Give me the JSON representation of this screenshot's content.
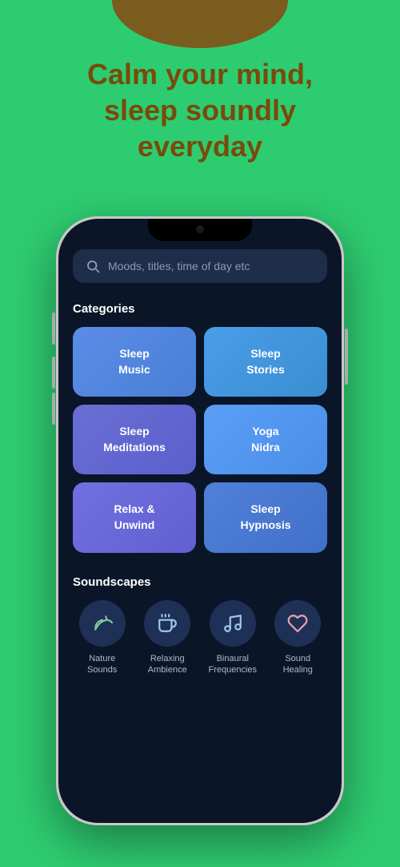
{
  "background": {
    "color": "#2ecc71",
    "arc_color": "#7a5c1e"
  },
  "headline": {
    "line1": "Calm your mind,",
    "line2": "sleep soundly",
    "line3": "everyday",
    "full": "Calm your mind,\nsleep soundly\neveryday",
    "color": "#7a4a0a"
  },
  "search": {
    "placeholder": "Moods, titles, time of day etc"
  },
  "categories_section": {
    "title": "Categories"
  },
  "categories": [
    {
      "id": "sleep-music",
      "label": "Sleep\nMusic",
      "css_class": "cat-sleep-music"
    },
    {
      "id": "sleep-stories",
      "label": "Sleep\nStories",
      "css_class": "cat-sleep-stories"
    },
    {
      "id": "sleep-meditations",
      "label": "Sleep\nMeditations",
      "css_class": "cat-sleep-meditations"
    },
    {
      "id": "yoga-nidra",
      "label": "Yoga\nNidra",
      "css_class": "cat-yoga-nidra"
    },
    {
      "id": "relax-unwind",
      "label": "Relax &\nUnwind",
      "css_class": "cat-relax-unwind"
    },
    {
      "id": "sleep-hypnosis",
      "label": "Sleep\nHypnosis",
      "css_class": "cat-sleep-hypnosis"
    }
  ],
  "soundscapes_section": {
    "title": "Soundscapes"
  },
  "soundscapes": [
    {
      "id": "nature-sounds",
      "icon": "🌿",
      "label": "Nature\nSounds"
    },
    {
      "id": "relaxing-ambience",
      "icon": "☕",
      "label": "Relaxing\nAmbience"
    },
    {
      "id": "binaural-frequencies",
      "icon": "🎵",
      "label": "Binaural\nFrequencies"
    },
    {
      "id": "sound-healing",
      "icon": "🤍",
      "label": "Sound\nHealing"
    }
  ]
}
